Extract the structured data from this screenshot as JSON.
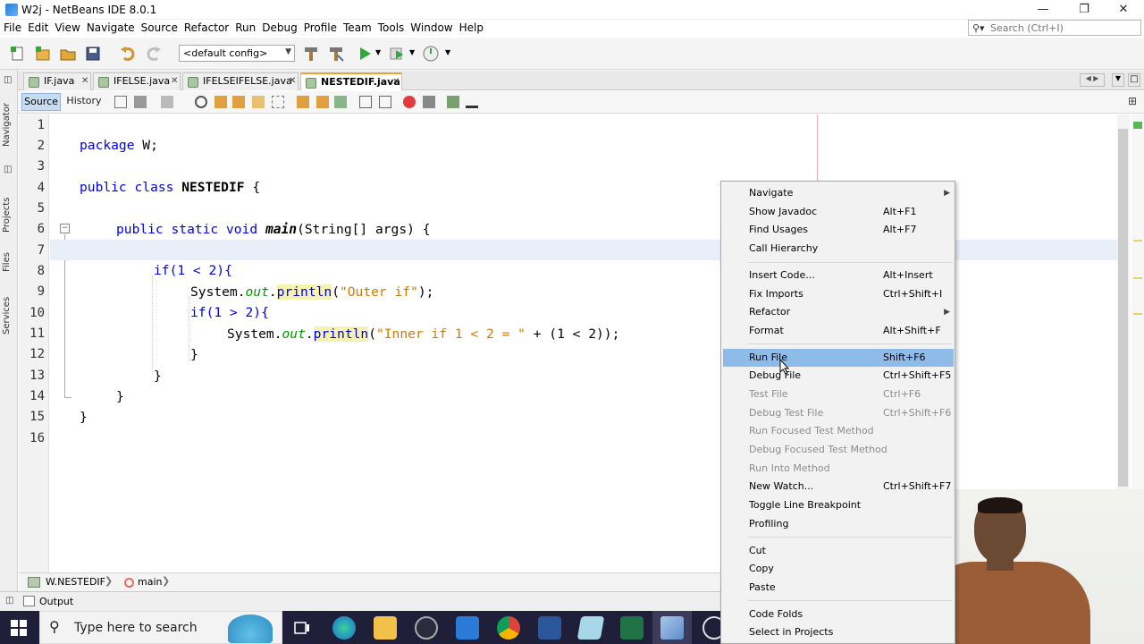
{
  "window": {
    "title": "W2j - NetBeans IDE 8.0.1"
  },
  "menubar": [
    "File",
    "Edit",
    "View",
    "Navigate",
    "Source",
    "Refactor",
    "Run",
    "Debug",
    "Profile",
    "Team",
    "Tools",
    "Window",
    "Help"
  ],
  "search": {
    "placeholder": "Search (Ctrl+I)"
  },
  "toolbar": {
    "config": "<default config>"
  },
  "side_tabs": [
    "Navigator",
    "Projects",
    "Files",
    "Services"
  ],
  "tabs": [
    {
      "label": "IF.java"
    },
    {
      "label": "IFELSE.java"
    },
    {
      "label": "IFELSEIFELSE.java"
    },
    {
      "label": "NESTEDIF.java",
      "active": true
    }
  ],
  "editor_toolbar": {
    "source": "Source",
    "history": "History"
  },
  "line_numbers": [
    "1",
    "2",
    "3",
    "4",
    "5",
    "6",
    "7",
    "8",
    "9",
    "10",
    "11",
    "12",
    "13",
    "14",
    "15",
    "16"
  ],
  "code": {
    "l2_kw": "package",
    "l2_rest": " W;",
    "l4_kw": "public class",
    "l4_cls": "NESTEDIF",
    "l4_rest": " {",
    "l6_kw": "public static void",
    "l6_mtd": "main",
    "l6_rest": "(String[] args) {",
    "l8": "if(1 < 2){",
    "l9_a": "System.",
    "l9_fld": "out",
    "l9_dot": ".",
    "l9_m": "println",
    "l9_p1": "(",
    "l9_str": "\"Outer if\"",
    "l9_p2": ");",
    "l10": "if(1 > 2){",
    "l11_a": "System.",
    "l11_fld": "out",
    "l11_dot": ".",
    "l11_m": "println",
    "l11_p1": "(",
    "l11_str": "\"Inner if 1 < 2 = \"",
    "l11_p2": " + (1 < 2));",
    "l12": "}",
    "l13": "}",
    "l14": "}",
    "l15": "}"
  },
  "breadcrumb": {
    "class": "W.NESTEDIF",
    "method": "main"
  },
  "output_tab": "Output",
  "taskbar": {
    "search": "Type here to search"
  },
  "context_menu": [
    {
      "label": "Navigate",
      "shortcut": "",
      "submenu": true
    },
    {
      "label": "Show Javadoc",
      "shortcut": "Alt+F1"
    },
    {
      "label": "Find Usages",
      "shortcut": "Alt+F7"
    },
    {
      "label": "Call Hierarchy",
      "shortcut": ""
    },
    {
      "label": "Insert Code...",
      "shortcut": "Alt+Insert"
    },
    {
      "label": "Fix Imports",
      "shortcut": "Ctrl+Shift+I"
    },
    {
      "label": "Refactor",
      "shortcut": "",
      "submenu": true
    },
    {
      "label": "Format",
      "shortcut": "Alt+Shift+F"
    },
    {
      "label": "Run File",
      "shortcut": "Shift+F6",
      "selected": true
    },
    {
      "label": "Debug File",
      "shortcut": "Ctrl+Shift+F5"
    },
    {
      "label": "Test File",
      "shortcut": "Ctrl+F6",
      "disabled": true
    },
    {
      "label": "Debug Test File",
      "shortcut": "Ctrl+Shift+F6",
      "disabled": true
    },
    {
      "label": "Run Focused Test Method",
      "shortcut": "",
      "disabled": true
    },
    {
      "label": "Debug Focused Test Method",
      "shortcut": "",
      "disabled": true
    },
    {
      "label": "Run Into Method",
      "shortcut": "",
      "disabled": true
    },
    {
      "label": "New Watch...",
      "shortcut": "Ctrl+Shift+F7"
    },
    {
      "label": "Toggle Line Breakpoint",
      "shortcut": ""
    },
    {
      "label": "Profiling",
      "shortcut": ""
    },
    {
      "label": "Cut",
      "shortcut": ""
    },
    {
      "label": "Copy",
      "shortcut": ""
    },
    {
      "label": "Paste",
      "shortcut": ""
    },
    {
      "label": "Code Folds",
      "shortcut": ""
    },
    {
      "label": "Select in Projects",
      "shortcut": ""
    }
  ],
  "colors": {
    "keyword": "#0000e6",
    "string": "#ce7b00",
    "field": "#009900",
    "selection": "#8fbbe8"
  }
}
